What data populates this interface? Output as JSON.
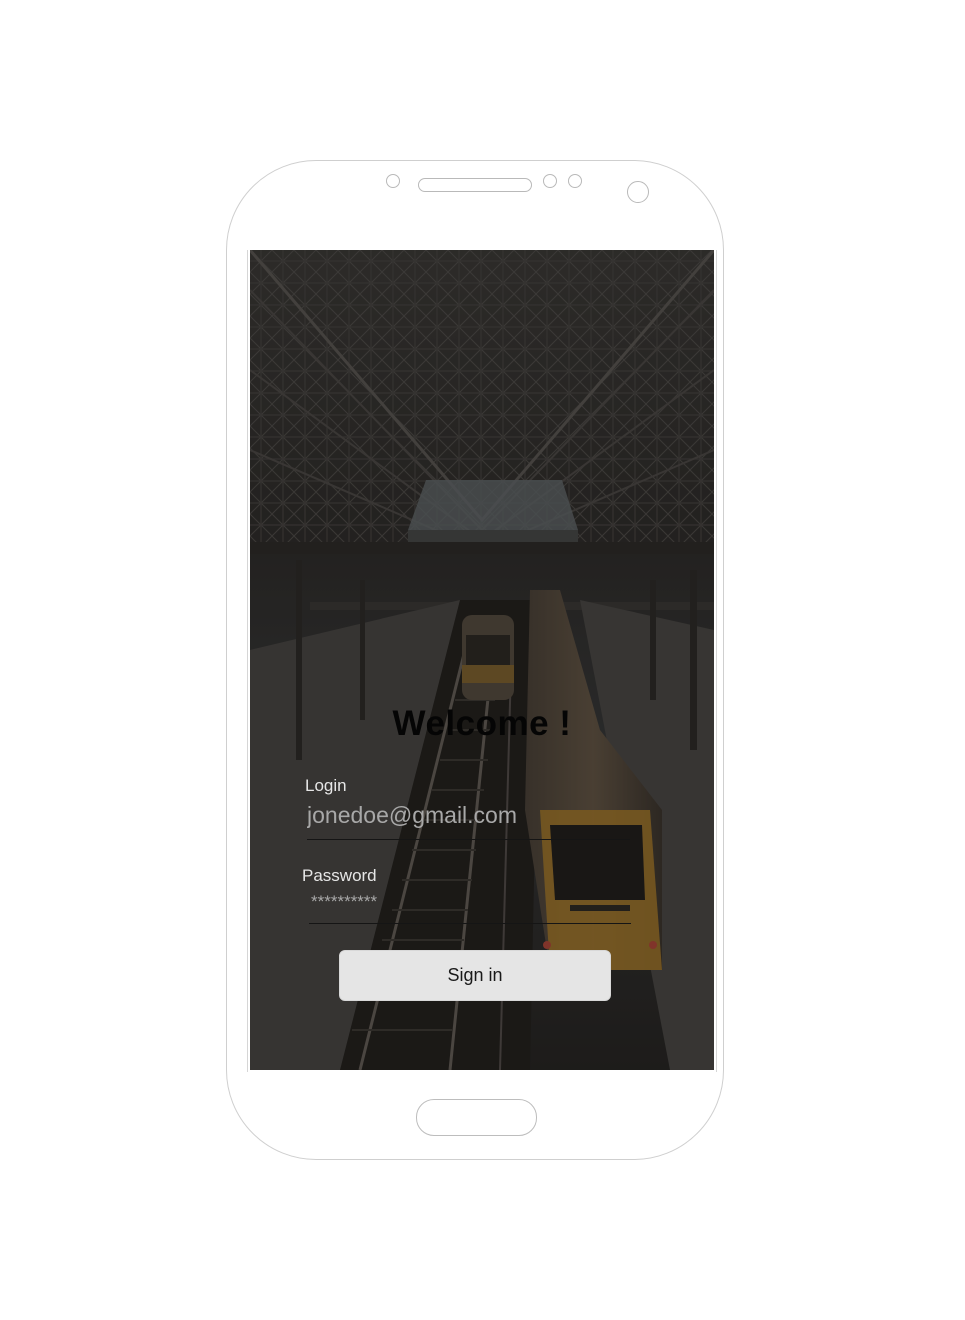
{
  "login_screen": {
    "title": "Welcome !",
    "login_label": "Login",
    "login_value": "jonedoe@gmail.com",
    "password_label": "Password",
    "password_value": "**********",
    "sign_in_label": "Sign in"
  },
  "colors": {
    "button_bg": "#e5e5e5",
    "label_text": "#e6e6e6",
    "title_text": "#050505",
    "field_text": "#a8a8a8",
    "train_yellow": "#b8862a"
  },
  "background_image": "train-station-icon"
}
